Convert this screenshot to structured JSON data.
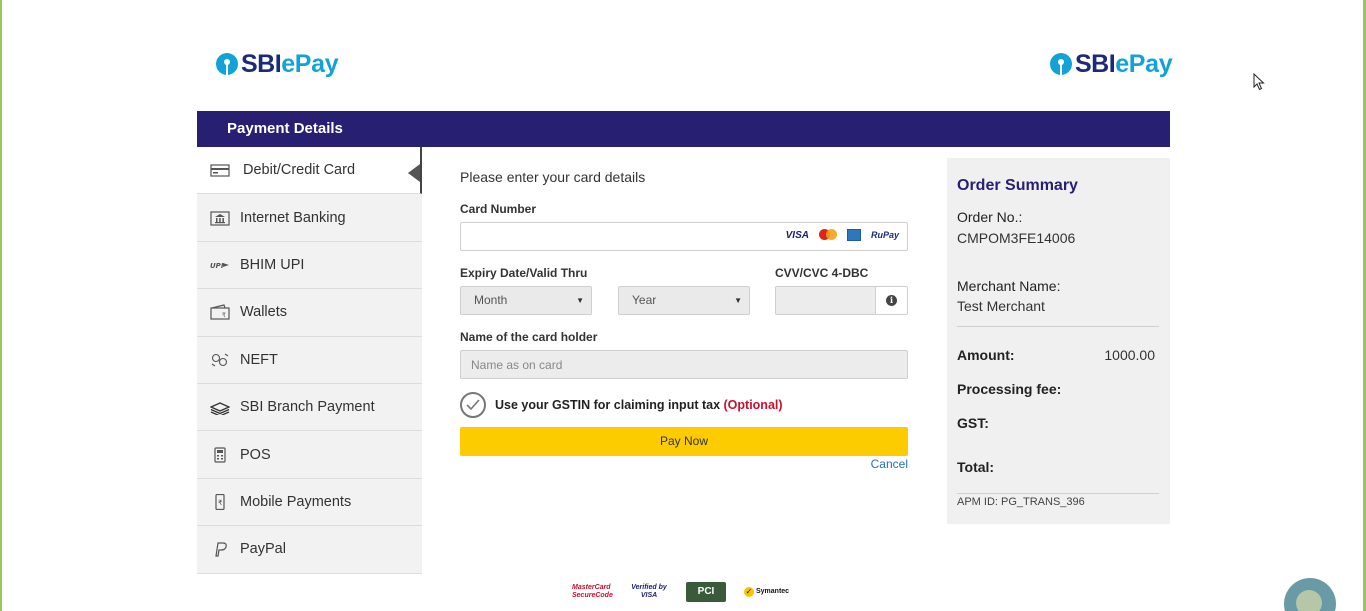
{
  "logo": {
    "sbi": "SBI",
    "epay": "ePay"
  },
  "header": {
    "title": "Payment Details"
  },
  "sidebar": {
    "items": [
      {
        "label": "Debit/Credit Card",
        "icon": "credit-card-icon",
        "active": true
      },
      {
        "label": "Internet Banking",
        "icon": "bank-icon"
      },
      {
        "label": "BHIM UPI",
        "icon": "upi-icon"
      },
      {
        "label": "Wallets",
        "icon": "wallet-icon"
      },
      {
        "label": "NEFT",
        "icon": "transfer-icon"
      },
      {
        "label": "SBI Branch Payment",
        "icon": "cash-stack-icon"
      },
      {
        "label": "POS",
        "icon": "pos-terminal-icon"
      },
      {
        "label": "Mobile Payments",
        "icon": "mobile-rupee-icon"
      },
      {
        "label": "PayPal",
        "icon": "paypal-icon"
      }
    ]
  },
  "form": {
    "intro": "Please enter your card details",
    "card_number_label": "Card Number",
    "card_brands": {
      "visa": "VISA",
      "rupay": "RuPay"
    },
    "expiry_label": "Expiry Date/Valid Thru",
    "month_value": "Month",
    "year_value": "Year",
    "cvv_label": "CVV/CVC 4-DBC",
    "holder_label": "Name of the card holder",
    "holder_placeholder": "Name as on card",
    "gst_text": "Use your GSTIN for claiming input tax",
    "gst_optional": "(Optional)",
    "pay_button": "Pay Now",
    "cancel": "Cancel"
  },
  "summary": {
    "title": "Order Summary",
    "order_no_label": "Order No.:",
    "order_no": "CMPOM3FE14006",
    "merchant_label": "Merchant Name:",
    "merchant": "Test Merchant",
    "amount_label": "Amount:",
    "amount": "1000.00",
    "fee_label": "Processing fee:",
    "gst_label": "GST:",
    "total_label": "Total:",
    "apm": "APM ID: PG_TRANS_396"
  },
  "badges": {
    "mastercard": "MasterCard SecureCode",
    "vbv": "Verified by VISA",
    "pci": "PCI",
    "symantec": "Symantec"
  },
  "colors": {
    "header": "#261f72",
    "pay_button": "#fdcc00",
    "brand_blue": "#12a3d6",
    "optional": "#c8102e"
  }
}
